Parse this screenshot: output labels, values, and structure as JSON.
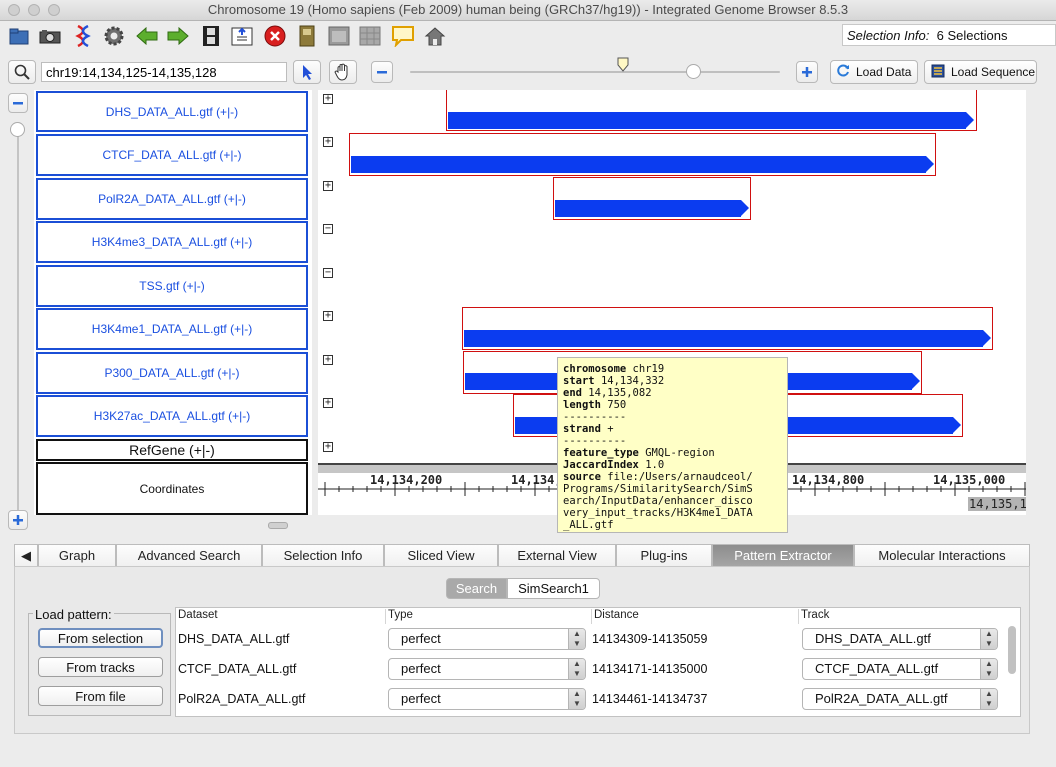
{
  "window": {
    "title": "Chromosome 19  (Homo sapiens (Feb 2009) human being (GRCh37/hg19)) - Integrated Genome Browser 8.5.3"
  },
  "toolbar": {
    "selection_info_label": "Selection Info:",
    "selection_info_value": "6 Selections",
    "icons": [
      "open-folder-icon",
      "camera-icon",
      "dna-icon",
      "gear-icon",
      "back-arrow-icon",
      "forward-arrow-icon",
      "film-icon",
      "upload-icon",
      "stop-icon",
      "bookmark-icon",
      "window-icon",
      "grid-icon",
      "comment-icon",
      "home-icon"
    ]
  },
  "navbar": {
    "location": "chr19:14,134,125-14,135,128",
    "load_data": "Load Data",
    "load_sequence": "Load Sequence",
    "zoom_fraction": 0.71
  },
  "tracks": [
    {
      "label": "DHS_DATA_ALL.gtf (+|-)",
      "expander": "+"
    },
    {
      "label": "CTCF_DATA_ALL.gtf (+|-)",
      "expander": "+"
    },
    {
      "label": "PolR2A_DATA_ALL.gtf (+|-)",
      "expander": "+"
    },
    {
      "label": "H3K4me3_DATA_ALL.gtf (+|-)",
      "expander": "−"
    },
    {
      "label": "TSS.gtf (+|-)",
      "expander": "−"
    },
    {
      "label": "H3K4me1_DATA_ALL.gtf (+|-)",
      "expander": "+"
    },
    {
      "label": "P300_DATA_ALL.gtf (+|-)",
      "expander": "+"
    },
    {
      "label": "H3K27ac_DATA_ALL.gtf (+|-)",
      "expander": "+"
    },
    {
      "label": "RefGene (+|-)",
      "expander": "+"
    },
    {
      "label": "Coordinates"
    }
  ],
  "ruler": {
    "ticks": [
      "14,134,200",
      "14,134,",
      "14,134,800",
      "14,135,000"
    ],
    "end_label": "14,135,1"
  },
  "tooltip": {
    "lines": [
      {
        "k": "chromosome",
        "v": "chr19"
      },
      {
        "k": "start",
        "v": "14,134,332"
      },
      {
        "k": "end",
        "v": "14,135,082"
      },
      {
        "k": "length",
        "v": "750"
      },
      {
        "k": "",
        "v": "----------"
      },
      {
        "k": "strand",
        "v": "+"
      },
      {
        "k": "",
        "v": "----------"
      },
      {
        "k": "feature_type",
        "v": "GMQL-region"
      },
      {
        "k": "JaccardIndex",
        "v": "1.0"
      },
      {
        "k": "source",
        "v": "file:/Users/arnaudceol/"
      },
      {
        "k": "",
        "v": "Programs/SimilaritySearch/SimS"
      },
      {
        "k": "",
        "v": "earch/InputData/enhancer_disco"
      },
      {
        "k": "",
        "v": "very_input_tracks/H3K4me1_DATA"
      },
      {
        "k": "",
        "v": "_ALL.gtf"
      }
    ]
  },
  "tabs": [
    "Graph",
    "Advanced Search",
    "Selection Info",
    "Sliced View",
    "External View",
    "Plug-ins",
    "Pattern Extractor",
    "Molecular Interactions"
  ],
  "active_tab": "Pattern Extractor",
  "subtabs": [
    "Search",
    "SimSearch1"
  ],
  "load_pattern": {
    "title": "Load pattern:",
    "buttons": [
      "From selection",
      "From tracks",
      "From file"
    ]
  },
  "table": {
    "headers": [
      "Dataset",
      "Type",
      "Distance",
      "Track"
    ],
    "rows": [
      {
        "dataset": "DHS_DATA_ALL.gtf",
        "type": "perfect",
        "distance": "14134309-14135059",
        "track": "DHS_DATA_ALL.gtf"
      },
      {
        "dataset": "CTCF_DATA_ALL.gtf",
        "type": "perfect",
        "distance": "14134171-14135000",
        "track": "CTCF_DATA_ALL.gtf"
      },
      {
        "dataset": "PolR2A_DATA_ALL.gtf",
        "type": "perfect",
        "distance": "14134461-14134737",
        "track": "PolR2A_DATA_ALL.gtf"
      }
    ]
  },
  "colors": {
    "feature": "#0b3cf0",
    "selection_box": "#d01010",
    "track_border": "#1b4fd6"
  }
}
